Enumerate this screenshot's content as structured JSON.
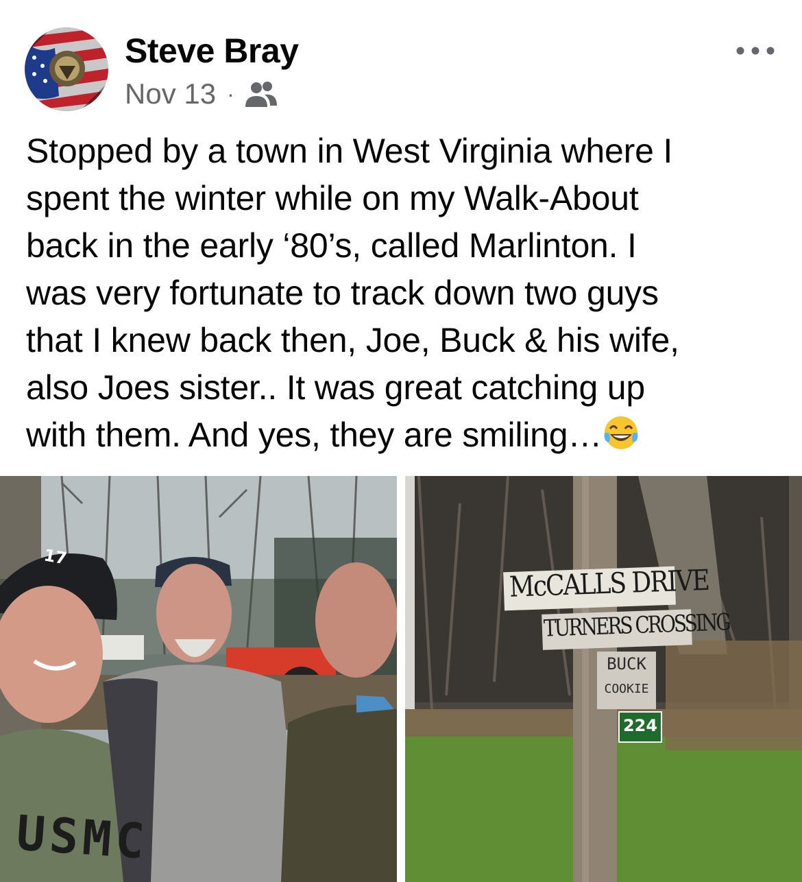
{
  "post": {
    "author": "Steve Bray",
    "date": "Nov 13",
    "separator": "·",
    "audience_icon": "friends-icon",
    "more_icon": "more-options-icon",
    "text_lines": [
      "Stopped by a town in West Virginia where I",
      "spent the winter while on my Walk-About",
      "back in the early ‘80’s, called Marlinton.  I",
      "was very fortunate to track down two guys",
      "that I knew back then, Joe, Buck & his wife,",
      "also Joes sister..  It was great catching up",
      "with them.  And yes, they are smiling…"
    ],
    "emoji": "tears-of-joy-emoji"
  },
  "photos": {
    "left": {
      "shirt_text": "USMC",
      "cap_number": "17"
    },
    "right": {
      "signs": [
        "McCALLS DRIVE",
        "TURNERS CROSSING",
        "BUCK",
        "COOKIE",
        "224"
      ]
    }
  }
}
